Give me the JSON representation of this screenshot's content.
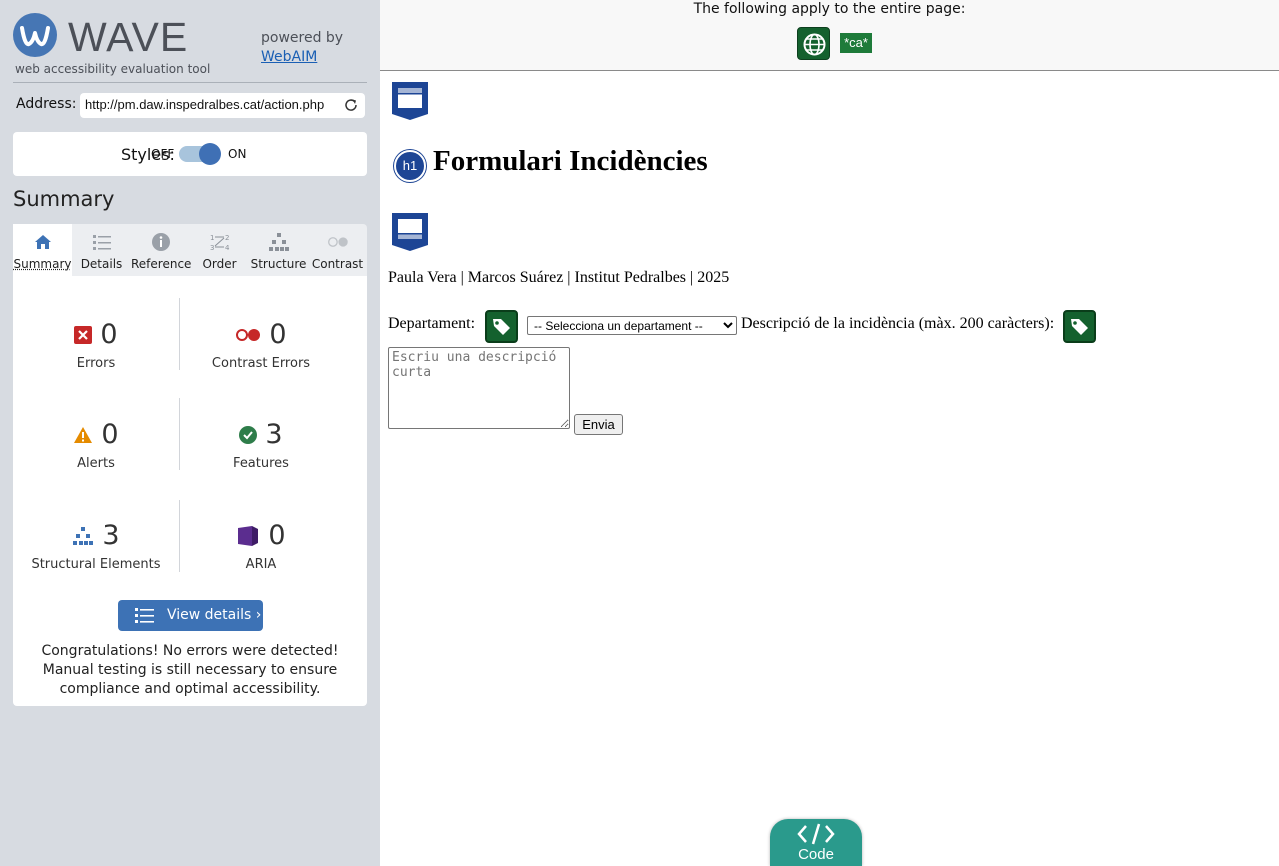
{
  "sidebar": {
    "brand": "WAVE",
    "tagline": "web accessibility evaluation tool",
    "powered_by": "powered by",
    "powered_link": "WebAIM",
    "address_label": "Address:",
    "address_value": "http://pm.daw.inspedralbes.cat/action.php",
    "styles_label": "Styles:",
    "styles_off": "OFF",
    "styles_on": "ON",
    "styles_enabled": true,
    "summary_heading": "Summary",
    "tabs": [
      {
        "label": "Summary",
        "icon": "home-icon",
        "active": true
      },
      {
        "label": "Details",
        "icon": "list-icon",
        "active": false
      },
      {
        "label": "Reference",
        "icon": "info-icon",
        "active": false
      },
      {
        "label": "Order",
        "icon": "order-icon",
        "active": false
      },
      {
        "label": "Structure",
        "icon": "structure-icon",
        "active": false
      },
      {
        "label": "Contrast",
        "icon": "contrast-icon",
        "active": false
      }
    ],
    "stats": {
      "errors": {
        "value": "0",
        "label": "Errors"
      },
      "contrast_errors": {
        "value": "0",
        "label": "Contrast Errors"
      },
      "alerts": {
        "value": "0",
        "label": "Alerts"
      },
      "features": {
        "value": "3",
        "label": "Features"
      },
      "structural": {
        "value": "3",
        "label": "Structural Elements"
      },
      "aria": {
        "value": "0",
        "label": "ARIA"
      }
    },
    "view_details_label": "View details ›",
    "congrats": "Congratulations! No errors were detected! Manual testing is still necessary to ensure compliance and optimal accessibility."
  },
  "main": {
    "page_note": "The following apply to the entire page:",
    "lang_badge": "*ca*",
    "heading_badge": "h1",
    "heading": "Formulari Incidències",
    "authors": "Paula Vera | Marcos Suárez | Institut Pedralbes | 2025",
    "dept_label": "Departament:",
    "dept_select": "-- Selecciona un departament --",
    "desc_label": "Descripció de la incidència (màx. 200 caràcters):",
    "desc_placeholder": "Escriu una descripció curta",
    "submit_label": "Envia",
    "code_label": "Code"
  },
  "colors": {
    "sidebar_bg": "#d7dbe1",
    "accent_blue": "#3d72b5",
    "feature_green": "#14612e",
    "error_red": "#c62828",
    "alert_orange": "#e58b00",
    "aria_purple": "#5b2d8f",
    "code_teal": "#2a9a8c"
  }
}
